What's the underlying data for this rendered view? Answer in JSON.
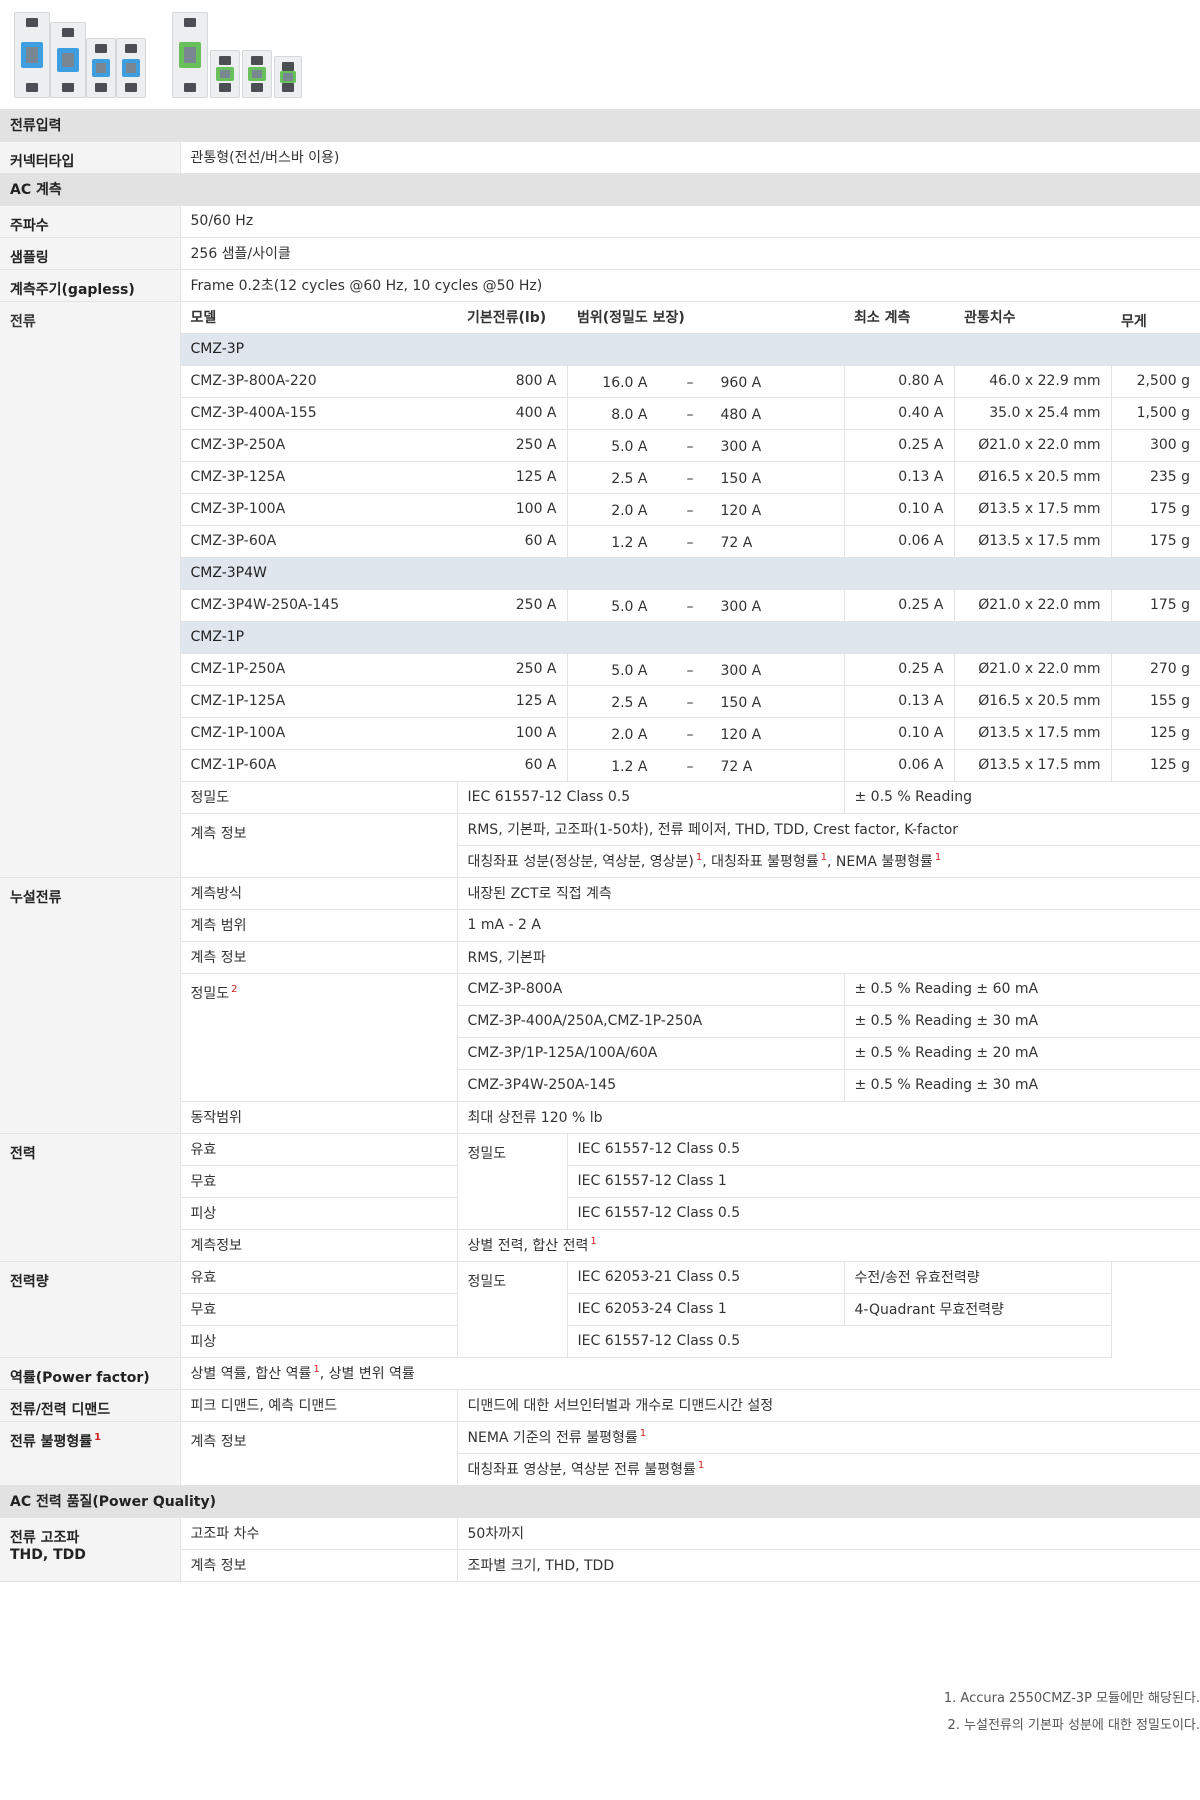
{
  "colors": {
    "section_bg": "#e2e2e2",
    "category_bg": "#f4f4f4",
    "group_bg": "#dfe6ee",
    "footnote_marker": "#d21f1f",
    "device_blue": "#3d9ee0",
    "device_green": "#68c05a"
  },
  "sections": {
    "current_input": "전류입력",
    "ac_measure": "AC 계측",
    "power_quality": "AC 전력 품질(Power Quality)"
  },
  "connector": {
    "label": "커넥터타입",
    "value": "관통형(전선/버스바 이용)"
  },
  "frequency": {
    "label": "주파수",
    "value": "50/60 Hz"
  },
  "sampling": {
    "label": "샘플링",
    "value": "256 샘플/사이클"
  },
  "period": {
    "label": "계측주기(gapless)",
    "value": "Frame 0.2초(12 cycles @60 Hz, 10 cycles @50 Hz)"
  },
  "current": {
    "label": "전류",
    "headers": {
      "model": "모델",
      "base": "기본전류(lb)",
      "range": "범위(정밀도 보장)",
      "min": "최소 계측",
      "size": "관통치수",
      "weight": "무게"
    },
    "dash": "–",
    "groups": [
      {
        "name": "CMZ-3P",
        "rows": [
          {
            "model": "CMZ-3P-800A-220",
            "base": "800 A",
            "lo": "16.0 A",
            "hi": "960 A",
            "min": "0.80 A",
            "size": "46.0 x 22.9 mm",
            "weight": "2,500 g"
          },
          {
            "model": "CMZ-3P-400A-155",
            "base": "400 A",
            "lo": "8.0 A",
            "hi": "480 A",
            "min": "0.40 A",
            "size": "35.0 x 25.4 mm",
            "weight": "1,500 g"
          },
          {
            "model": "CMZ-3P-250A",
            "base": "250 A",
            "lo": "5.0 A",
            "hi": "300 A",
            "min": "0.25 A",
            "size": "Ø21.0 x 22.0 mm",
            "weight": "300 g"
          },
          {
            "model": "CMZ-3P-125A",
            "base": "125 A",
            "lo": "2.5 A",
            "hi": "150 A",
            "min": "0.13 A",
            "size": "Ø16.5 x 20.5 mm",
            "weight": "235 g"
          },
          {
            "model": "CMZ-3P-100A",
            "base": "100 A",
            "lo": "2.0 A",
            "hi": "120 A",
            "min": "0.10 A",
            "size": "Ø13.5 x 17.5 mm",
            "weight": "175 g"
          },
          {
            "model": "CMZ-3P-60A",
            "base": "60 A",
            "lo": "1.2 A",
            "hi": "72 A",
            "min": "0.06 A",
            "size": "Ø13.5 x 17.5 mm",
            "weight": "175 g"
          }
        ]
      },
      {
        "name": "CMZ-3P4W",
        "rows": [
          {
            "model": "CMZ-3P4W-250A-145",
            "base": "250 A",
            "lo": "5.0 A",
            "hi": "300 A",
            "min": "0.25 A",
            "size": "Ø21.0 x 22.0 mm",
            "weight": "175 g"
          }
        ]
      },
      {
        "name": "CMZ-1P",
        "rows": [
          {
            "model": "CMZ-1P-250A",
            "base": "250 A",
            "lo": "5.0 A",
            "hi": "300 A",
            "min": "0.25 A",
            "size": "Ø21.0 x 22.0 mm",
            "weight": "270 g"
          },
          {
            "model": "CMZ-1P-125A",
            "base": "125 A",
            "lo": "2.5 A",
            "hi": "150 A",
            "min": "0.13 A",
            "size": "Ø16.5 x 20.5 mm",
            "weight": "155 g"
          },
          {
            "model": "CMZ-1P-100A",
            "base": "100 A",
            "lo": "2.0 A",
            "hi": "120 A",
            "min": "0.10 A",
            "size": "Ø13.5 x 17.5 mm",
            "weight": "125 g"
          },
          {
            "model": "CMZ-1P-60A",
            "base": "60 A",
            "lo": "1.2 A",
            "hi": "72 A",
            "min": "0.06 A",
            "size": "Ø13.5 x 17.5 mm",
            "weight": "125 g"
          }
        ]
      }
    ],
    "accuracy": {
      "label": "정밀도",
      "standard": "IEC 61557-12 Class 0.5",
      "reading": "± 0.5 % Reading"
    },
    "info": {
      "label": "계측 정보",
      "line1": "RMS, 기본파, 고조파(1-50차), 전류 페이저, THD, TDD, Crest factor, K-factor",
      "line2a": "대칭좌표 성분(정상분, 역상분, 영상분)",
      "line2b": ", 대칭좌표 불평형률",
      "line2c": ", NEMA 불평형률",
      "mark": "1"
    }
  },
  "leakage": {
    "label": "누설전류",
    "method": {
      "label": "계측방식",
      "value": "내장된 ZCT로 직접 계측"
    },
    "range": {
      "label": "계측 범위",
      "value": "1 mA - 2 A"
    },
    "info": {
      "label": "계측 정보",
      "value": "RMS, 기본파"
    },
    "accuracy": {
      "label": "정밀도",
      "mark": "2",
      "rows": [
        {
          "model": "CMZ-3P-800A",
          "value": "± 0.5 % Reading  ±  60 mA"
        },
        {
          "model": "CMZ-3P-400A/250A,CMZ-1P-250A",
          "value": "± 0.5 % Reading  ±  30 mA"
        },
        {
          "model": "CMZ-3P/1P-125A/100A/60A",
          "value": "± 0.5 % Reading  ±  20 mA"
        },
        {
          "model": "CMZ-3P4W-250A-145",
          "value": "± 0.5 % Reading  ±  30 mA"
        }
      ]
    },
    "operating": {
      "label": "동작범위",
      "value": "최대 상전류 120 % lb"
    }
  },
  "power": {
    "label": "전력",
    "accuracy_label": "정밀도",
    "rows": [
      {
        "name": "유효",
        "value": "IEC 61557-12 Class 0.5"
      },
      {
        "name": "무효",
        "value": "IEC 61557-12 Class 1"
      },
      {
        "name": "피상",
        "value": "IEC 61557-12 Class 0.5"
      }
    ],
    "info": {
      "label": "계측정보",
      "value": "상별 전력, 합산 전력",
      "mark": "1"
    }
  },
  "energy": {
    "label": "전력량",
    "accuracy_label": "정밀도",
    "rows": [
      {
        "name": "유효",
        "value": "IEC 62053-21 Class 0.5",
        "note": "수전/송전 유효전력량"
      },
      {
        "name": "무효",
        "value": "IEC 62053-24 Class 1",
        "note": "4-Quadrant 무효전력량"
      },
      {
        "name": "피상",
        "value": "IEC 61557-12 Class 0.5",
        "note": ""
      }
    ]
  },
  "pf": {
    "label": "역률(Power factor)",
    "value_a": "상별 역률, 합산 역률",
    "value_b": ", 상별 변위 역률",
    "mark": "1"
  },
  "demand": {
    "label": "전류/전력 디맨드",
    "value": "피크 디맨드, 예측 디맨드",
    "desc": "디맨드에 대한 서브인터벌과 개수로 디맨드시간 설정"
  },
  "unbalance": {
    "label": "전류 불평형률",
    "mark": "1",
    "info_label": "계측 정보",
    "line1": "NEMA 기준의 전류 불평형률",
    "line2": "대칭좌표 영상분, 역상분 전류 불평형률"
  },
  "harmonic": {
    "label_line1": "전류 고조파",
    "label_line2": "THD, TDD",
    "order_label": "고조파 차수",
    "order_value": "50차까지",
    "info_label": "계측 정보",
    "info_value": "조파별 크기, THD, TDD"
  },
  "footnotes": [
    "1. Accura 2550CMZ-3P 모듈에만 해당된다.",
    "2. 누설전류의 기본파 성분에 대한 정밀도이다."
  ]
}
